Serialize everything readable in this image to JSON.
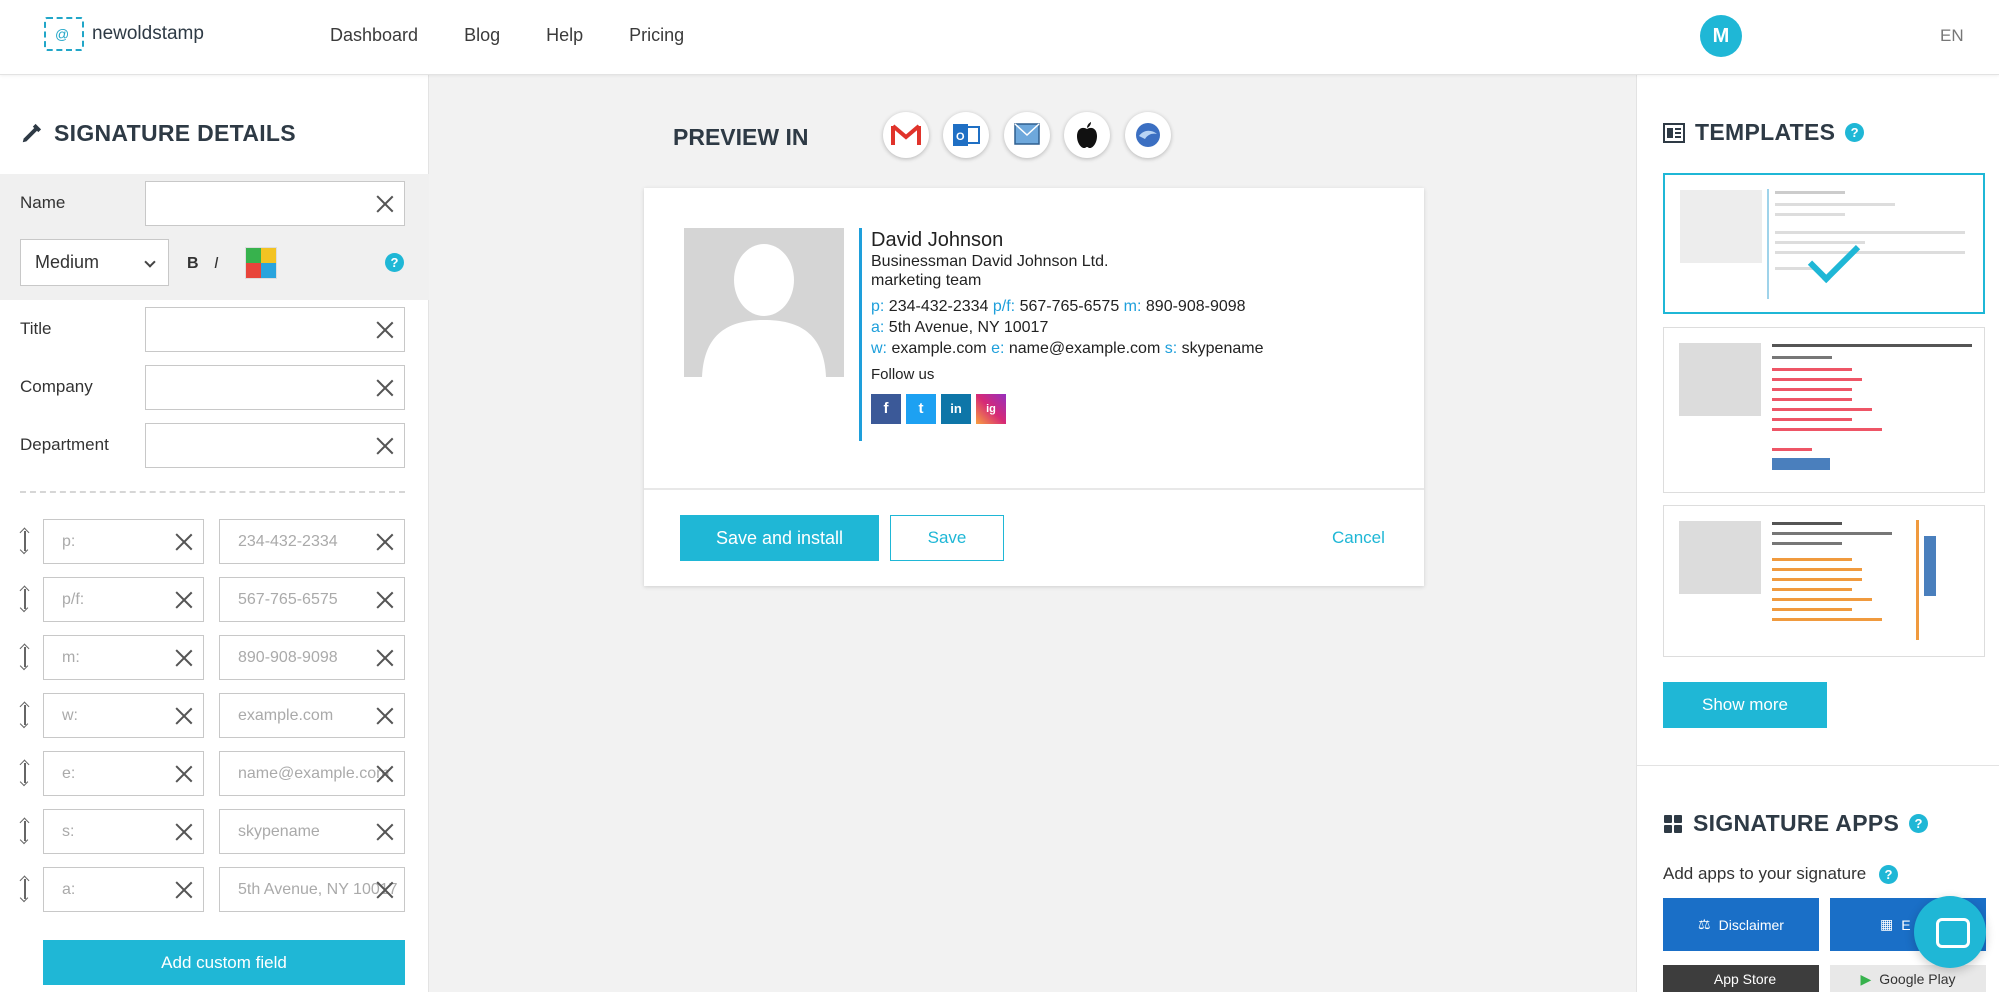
{
  "header": {
    "logo_text": "newoldstamp",
    "nav": [
      "Dashboard",
      "Blog",
      "Help",
      "Pricing"
    ],
    "avatar_initial": "M",
    "lang": "EN"
  },
  "left": {
    "title": "SIGNATURE DETAILS",
    "name_label": "Name",
    "size_value": "Medium",
    "bold": "B",
    "italic": "I",
    "help": "?",
    "title_label": "Title",
    "company_label": "Company",
    "department_label": "Department",
    "fields": [
      {
        "label_placeholder": "p:",
        "value_placeholder": "234-432-2334"
      },
      {
        "label_placeholder": "p/f:",
        "value_placeholder": "567-765-6575"
      },
      {
        "label_placeholder": "m:",
        "value_placeholder": "890-908-9098"
      },
      {
        "label_placeholder": "w:",
        "value_placeholder": "example.com"
      },
      {
        "label_placeholder": "e:",
        "value_placeholder": "name@example.com"
      },
      {
        "label_placeholder": "s:",
        "value_placeholder": "skypename"
      },
      {
        "label_placeholder": "a:",
        "value_placeholder": "5th Avenue, NY 10017"
      }
    ],
    "add_custom": "Add custom field"
  },
  "center": {
    "preview_label": "PREVIEW IN",
    "clients": [
      "gmail-icon",
      "outlook-icon",
      "mac-mail-icon",
      "apple-icon",
      "thunderbird-icon"
    ],
    "signature": {
      "name": "David Johnson",
      "position": "Businessman David Johnson Ltd.",
      "department": "marketing team",
      "p_key": "p:",
      "p_val": "234-432-2334",
      "pf_key": "p/f:",
      "pf_val": "567-765-6575",
      "m_key": "m:",
      "m_val": "890-908-9098",
      "a_key": "a:",
      "a_val": "5th Avenue, NY 10017",
      "w_key": "w:",
      "w_val": "example.com",
      "e_key": "e:",
      "e_val": "name@example.com",
      "s_key": "s:",
      "s_val": "skypename",
      "follow": "Follow us",
      "social": [
        "f",
        "t",
        "in",
        "ig"
      ]
    },
    "save_install": "Save and install",
    "save": "Save",
    "cancel": "Cancel"
  },
  "right": {
    "templates_title": "TEMPLATES",
    "help": "?",
    "show_more": "Show more",
    "apps_title": "SIGNATURE APPS",
    "apps_sub": "Add apps to your signature",
    "apps": [
      "Disclaimer",
      "E",
      "App Store",
      "Google Play"
    ]
  },
  "colors": {
    "accent": "#1fb7d6",
    "link_blue": "#1e9fdb",
    "dark_blue_button": "#1a6fc7",
    "dark_gray_button": "#3d3d3d"
  }
}
